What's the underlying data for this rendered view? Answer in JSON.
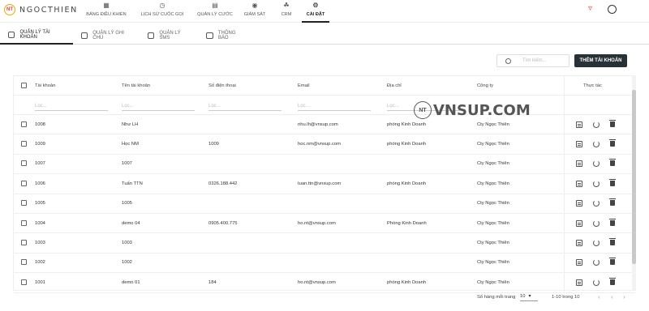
{
  "app": {
    "logo_badge": "NT",
    "name": "NGOCTHIEN"
  },
  "nav": [
    {
      "label": "BẢNG ĐIỀU KHIỂN",
      "icon": "dashboard-icon"
    },
    {
      "label": "LỊCH SỬ CUỘC GỌI",
      "icon": "history-icon"
    },
    {
      "label": "QUẢN LÝ CƯỚC",
      "icon": "billing-icon"
    },
    {
      "label": "GIÁM SÁT",
      "icon": "monitor-icon"
    },
    {
      "label": "CRM",
      "icon": "headset-icon"
    },
    {
      "label": "CÀI ĐẶT",
      "icon": "gear-icon",
      "active": true
    }
  ],
  "subtabs": [
    {
      "label": "QUẢN LÝ TÀI KHOẢN",
      "active": true
    },
    {
      "label": "QUẢN LÝ GHI CHÚ"
    },
    {
      "label": "QUẢN LÝ SMS"
    },
    {
      "label": "THÔNG BÁO"
    }
  ],
  "toolbar": {
    "search_placeholder": "Tìm kiếm...",
    "add_label": "THÊM TÀI KHOẢN"
  },
  "table": {
    "columns": [
      "Tài khoản",
      "Tên tài khoản",
      "Số điện thoại",
      "Email",
      "Địa chỉ",
      "Công ty",
      "Thực tác"
    ],
    "filter_placeholder": "Lọc...",
    "rows": [
      [
        "1008",
        "Như LH",
        "",
        "nhu.lh@vnsup.com",
        "phòng Kinh Doanh",
        "Cty Ngọc Thiên"
      ],
      [
        "1009",
        "Học NM",
        "1009",
        "hoc.nm@vnsup.com",
        "phòng Kinh Doanh",
        "Cty Ngọc Thiên"
      ],
      [
        "1007",
        "1007",
        "",
        "",
        "",
        "Cty Ngọc Thiên"
      ],
      [
        "1006",
        "Tuấn TTN",
        "0326.188.442",
        "tuan.ttn@vnsup.com",
        "phòng Kinh Doanh",
        "Cty Ngọc Thiên"
      ],
      [
        "1005",
        "1005",
        "",
        "",
        "",
        "Cty Ngọc Thiên"
      ],
      [
        "1004",
        "demo 04",
        "0905.400.775",
        "ho.nt@vnsup.com",
        "Phòng Kinh Doanh",
        "Cty Ngọc Thiên"
      ],
      [
        "1003",
        "1003",
        "",
        "",
        "",
        "Cty Ngọc Thiên"
      ],
      [
        "1002",
        "1002",
        "",
        "",
        "",
        "Cty Ngọc Thiên"
      ],
      [
        "1001",
        "demo 01",
        "184",
        "ho.nt@vnsup.com",
        "phòng Kinh Doanh",
        "Cty Ngọc Thiên"
      ]
    ]
  },
  "watermark": {
    "badge": "NT",
    "text": "VNSUP.COM"
  },
  "footer": {
    "rows_per_page_label": "Số hàng mỗi trang",
    "rows_per_page": "10",
    "range": "1-10 trong 10"
  },
  "colors": {
    "accent_dark": "#263238",
    "user_icon": "#e53935"
  }
}
